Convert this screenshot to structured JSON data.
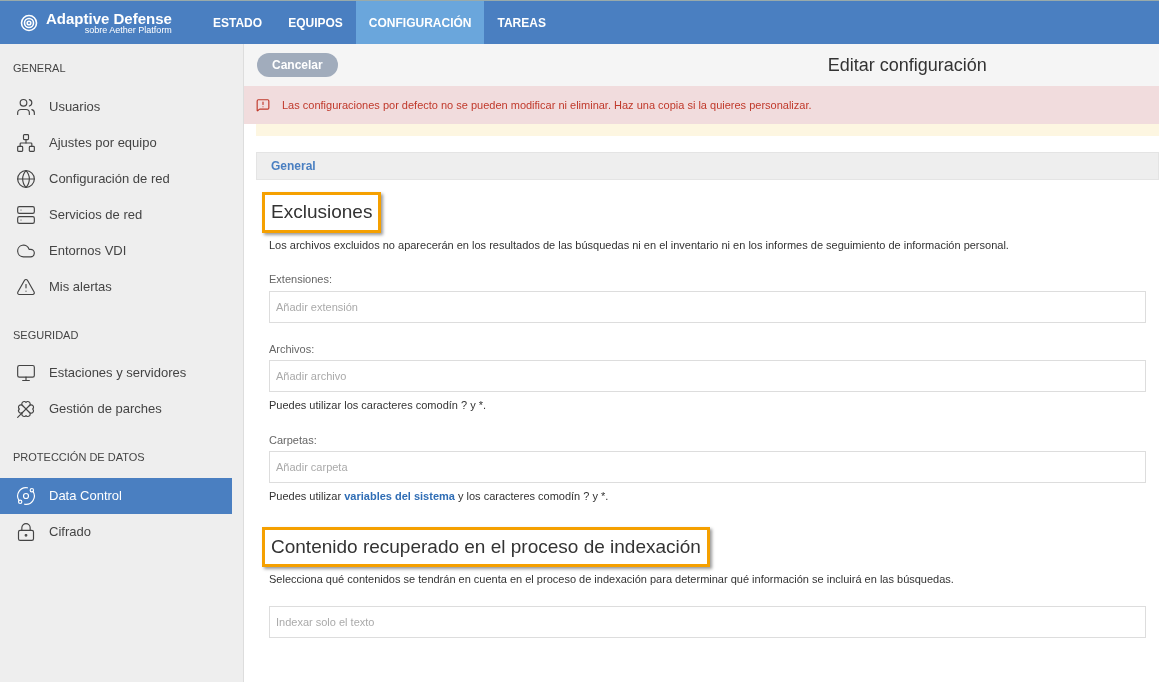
{
  "brand": {
    "title": "Adaptive Defense",
    "subtitle": "sobre Aether Platform"
  },
  "nav": [
    {
      "label": "ESTADO",
      "selected": false
    },
    {
      "label": "EQUIPOS",
      "selected": false
    },
    {
      "label": "CONFIGURACIÓN",
      "selected": true
    },
    {
      "label": "TAREAS",
      "selected": false
    }
  ],
  "sidebar": [
    {
      "title": "GENERAL",
      "items": [
        {
          "label": "Usuarios",
          "selected": false
        },
        {
          "label": "Ajustes por equipo",
          "selected": false
        },
        {
          "label": "Configuración de red",
          "selected": false
        },
        {
          "label": "Servicios de red",
          "selected": false
        },
        {
          "label": "Entornos VDI",
          "selected": false
        },
        {
          "label": "Mis alertas",
          "selected": false
        }
      ]
    },
    {
      "title": "SEGURIDAD",
      "items": [
        {
          "label": "Estaciones y servidores",
          "selected": false
        },
        {
          "label": "Gestión de parches",
          "selected": false
        }
      ]
    },
    {
      "title": "PROTECCIÓN DE DATOS",
      "items": [
        {
          "label": "Data Control",
          "selected": true
        },
        {
          "label": "Cifrado",
          "selected": false
        }
      ]
    }
  ],
  "toolbar": {
    "cancel_button": "Cancelar",
    "title": "Editar configuración"
  },
  "alert": "Las configuraciones por defecto no se pueden modificar ni eliminar. Haz una copia si la quieres personalizar.",
  "panel_title": "General",
  "sections": [
    {
      "heading": "Exclusiones",
      "highlighted": true,
      "description": "Los archivos excluidos no aparecerán en los resultados de las búsquedas ni en el inventario ni en los informes de seguimiento de información personal.",
      "fields": [
        {
          "label": "Extensiones:",
          "placeholder": "Añadir extensión"
        },
        {
          "label": "Archivos:",
          "placeholder": "Añadir archivo",
          "hint": {
            "before": "Puedes utilizar los caracteres comodín ? y *."
          }
        },
        {
          "label": "Carpetas:",
          "placeholder": "Añadir carpeta",
          "hint": {
            "before": "Puedes utilizar",
            "link": "variables del sistema",
            "after": "y los caracteres comodín ? y *."
          }
        }
      ]
    },
    {
      "heading": "Contenido recuperado en el proceso de indexación",
      "highlighted": true,
      "description": "Selecciona qué contenidos se tendrán en cuenta en el proceso de indexación para determinar qué información se incluirá en las búsquedas.",
      "fields": [
        {
          "placeholder": "Indexar solo el texto"
        }
      ]
    }
  ]
}
